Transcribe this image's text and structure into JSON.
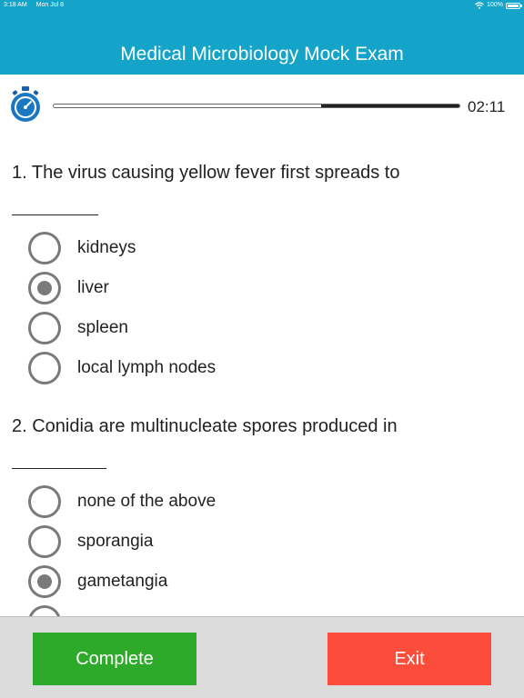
{
  "status_bar": {
    "time": "3:18 AM",
    "date": "Mon Jul 8",
    "battery": "100%"
  },
  "header": {
    "title": "Medical Microbiology Mock Exam"
  },
  "timer": {
    "time_left": "02:11",
    "progress_remaining_fraction": 0.34
  },
  "questions": [
    {
      "text": "1. The virus causing yellow fever first spreads to",
      "options": [
        {
          "label": "kidneys",
          "selected": false
        },
        {
          "label": "liver",
          "selected": true
        },
        {
          "label": "spleen",
          "selected": false
        },
        {
          "label": "local lymph nodes",
          "selected": false
        }
      ]
    },
    {
      "text": "2. Conidia are multinucleate spores produced in",
      "options": [
        {
          "label": "none of the above",
          "selected": false
        },
        {
          "label": "sporangia",
          "selected": false
        },
        {
          "label": "gametangia",
          "selected": true
        },
        {
          "label": "",
          "selected": false
        }
      ]
    }
  ],
  "footer": {
    "complete_label": "Complete",
    "exit_label": "Exit"
  },
  "colors": {
    "header_bg": "#15a4c9",
    "complete_bg": "#2eaa2b",
    "exit_bg": "#fc4c3b",
    "radio": "#7a7a7a"
  }
}
